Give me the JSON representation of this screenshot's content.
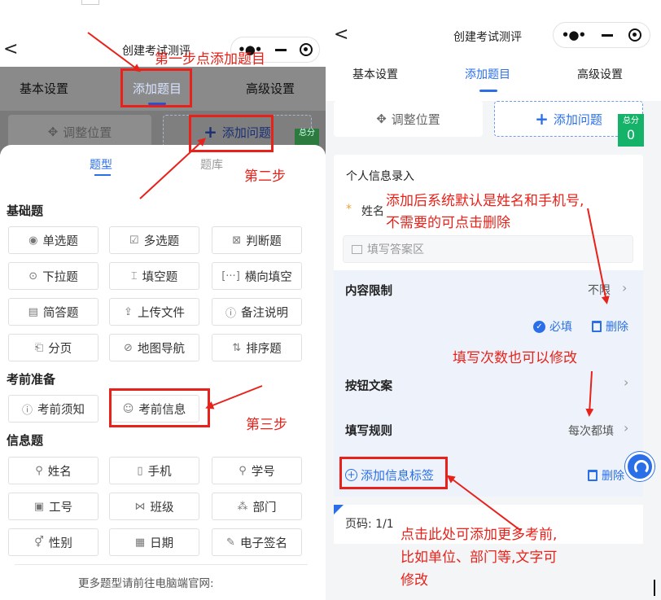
{
  "left": {
    "back": "<",
    "title": "创建考试测评",
    "tabs": [
      "基本设置",
      "添加题目",
      "高级设置"
    ],
    "adjust_label": "调整位置",
    "add_question_label": "添加问题",
    "score_label": "总分",
    "sheet_tabs": [
      "题型",
      "题库"
    ],
    "sections": {
      "basic": "基础题",
      "prep": "考前准备",
      "info": "信息题"
    },
    "basic_items": [
      {
        "icon": "◉",
        "label": "单选题"
      },
      {
        "icon": "☑",
        "label": "多选题"
      },
      {
        "icon": "⊠",
        "label": "判断题"
      },
      {
        "icon": "⊙",
        "label": "下拉题"
      },
      {
        "icon": "⌶",
        "label": "填空题"
      },
      {
        "icon": "[···]",
        "label": "横向填空"
      },
      {
        "icon": "▤",
        "label": "简答题"
      },
      {
        "icon": "⇪",
        "label": "上传文件"
      },
      {
        "icon": "ⓘ",
        "label": "备注说明"
      },
      {
        "icon": "⎗",
        "label": "分页"
      },
      {
        "icon": "⊘",
        "label": "地图导航"
      },
      {
        "icon": "⇅",
        "label": "排序题"
      }
    ],
    "prep_items": [
      {
        "icon": "ⓘ",
        "label": "考前须知"
      },
      {
        "icon": "☺",
        "label": "考前信息"
      }
    ],
    "info_items": [
      {
        "icon": "⚲",
        "label": "姓名"
      },
      {
        "icon": "▯",
        "label": "手机"
      },
      {
        "icon": "⚲",
        "label": "学号"
      },
      {
        "icon": "▣",
        "label": "工号"
      },
      {
        "icon": "⋈",
        "label": "班级"
      },
      {
        "icon": "⁂",
        "label": "部门"
      },
      {
        "icon": "⚥",
        "label": "性别"
      },
      {
        "icon": "▦",
        "label": "日期"
      },
      {
        "icon": "✎",
        "label": "电子签名"
      }
    ],
    "more_text": "更多题型请前往电脑端官网:"
  },
  "right": {
    "back": "<",
    "title": "创建考试测评",
    "tabs": [
      "基本设置",
      "添加题目",
      "高级设置"
    ],
    "adjust_label": "调整位置",
    "add_question_label": "添加问题",
    "score_label": "总分",
    "score_value": "0",
    "card_title": "个人信息录入",
    "required_star": "*",
    "name_label": "姓名",
    "answer_placeholder": "填写答案区",
    "content_limit_label": "内容限制",
    "content_limit_value": "不限",
    "required_label": "必填",
    "delete_label": "删除",
    "button_text_label": "按钮文案",
    "fill_rule_label": "填写规则",
    "fill_rule_value": "每次都填",
    "add_tag_label": "添加信息标签",
    "delete_label_2": "删除",
    "page_label": "页码: 1/1"
  },
  "annotations": {
    "step1": "第一步点添加题目",
    "step2": "第二步",
    "step3": "第三步",
    "note1_line1": "添加后系统默认是姓名和手机号,",
    "note1_line2": "不需要的可点击删除",
    "note2": "填写次数也可以修改",
    "note3_line1": "点击此处可添加更多考前,",
    "note3_line2": "比如单位、部门等,文字可",
    "note3_line3": "修改"
  },
  "colors": {
    "accent": "#2a6fe8",
    "annotation": "#e8221a",
    "score_green": "#15b36a",
    "required_star": "#f2a33a"
  }
}
